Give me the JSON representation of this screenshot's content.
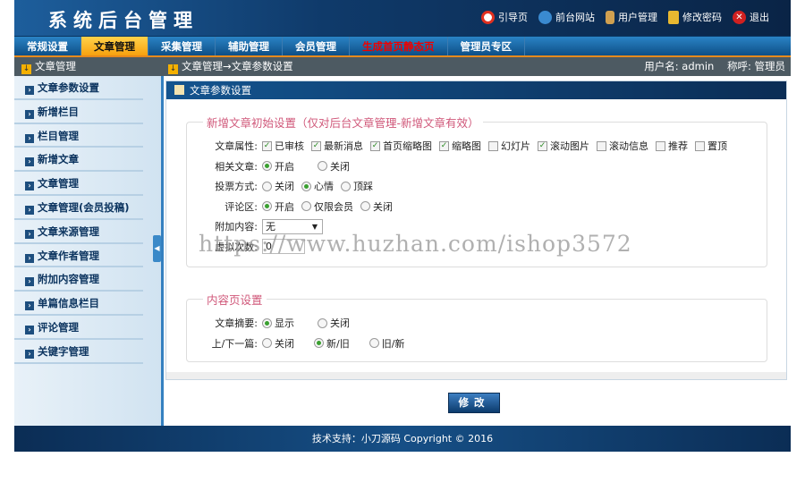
{
  "header": {
    "title": "系统后台管理",
    "links": [
      {
        "label": "引导页",
        "icon": "lifebuoy-icon",
        "color": "#e03020"
      },
      {
        "label": "前台网站",
        "icon": "globe-icon",
        "color": "#3a8ad0"
      },
      {
        "label": "用户管理",
        "icon": "user-icon",
        "color": "#d0a050"
      },
      {
        "label": "修改密码",
        "icon": "lock-icon",
        "color": "#e8b830"
      },
      {
        "label": "退出",
        "icon": "close-icon",
        "color": "#d02020"
      }
    ]
  },
  "nav": [
    {
      "label": "常规设置"
    },
    {
      "label": "文章管理"
    },
    {
      "label": "采集管理"
    },
    {
      "label": "辅助管理"
    },
    {
      "label": "会员管理"
    },
    {
      "label": "生成首页静态页"
    },
    {
      "label": "管理员专区"
    }
  ],
  "subbar": {
    "side_title": "文章管理",
    "breadcrumb": "文章管理→文章参数设置",
    "user": "用户名: admin",
    "role": "称呼: 管理员"
  },
  "sidebar": [
    "文章参数设置",
    "新增栏目",
    "栏目管理",
    "新增文章",
    "文章管理",
    "文章管理(会员投稿)",
    "文章来源管理",
    "文章作者管理",
    "附加内容管理",
    "单篇信息栏目",
    "评论管理",
    "关键字管理"
  ],
  "panel": {
    "title": "文章参数设置",
    "section1": {
      "legend": "新增文章初始设置（仅对后台文章管理-新增文章有效）",
      "attr_label": "文章属性:",
      "attrs": [
        {
          "label": "已审核",
          "checked": true
        },
        {
          "label": "最新消息",
          "checked": true
        },
        {
          "label": "首页缩略图",
          "checked": true
        },
        {
          "label": "缩略图",
          "checked": true
        },
        {
          "label": "幻灯片",
          "checked": false
        },
        {
          "label": "滚动图片",
          "checked": true
        },
        {
          "label": "滚动信息",
          "checked": false
        },
        {
          "label": "推荐",
          "checked": false
        },
        {
          "label": "置顶",
          "checked": false
        }
      ],
      "related_label": "相关文章:",
      "related": [
        "开启",
        "关闭"
      ],
      "vote_label": "投票方式:",
      "vote": [
        "关闭",
        "心情",
        "顶踩"
      ],
      "comment_label": "评论区:",
      "comment": [
        "开启",
        "仅限会员",
        "关闭"
      ],
      "extra_label": "附加内容:",
      "extra_value": "无",
      "count_label": "虚拟次数:",
      "count_value": "0"
    },
    "section2": {
      "legend": "内容页设置",
      "summary_label": "文章摘要:",
      "summary": [
        "显示",
        "关闭"
      ],
      "prevnext_label": "上/下一篇:",
      "prevnext": [
        "关闭",
        "新/旧",
        "旧/新"
      ]
    },
    "submit": "修改"
  },
  "footer": "技术支持：小刀源码 Copyright © 2016",
  "watermark": "https://www.huzhan.com/ishop3572"
}
